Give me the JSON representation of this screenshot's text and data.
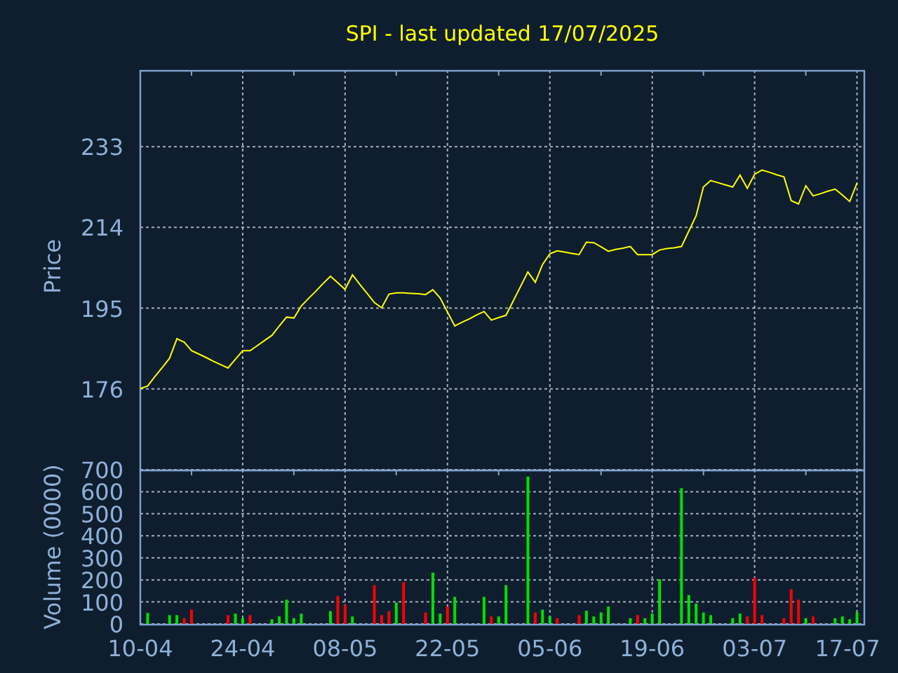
{
  "title": "SPI - last updated 17/07/2025",
  "price_chart": {
    "chart_data": {
      "type": "line",
      "grid": true,
      "ylabel": "Price",
      "ylim": [
        157,
        251
      ],
      "yticks": [
        176,
        195,
        214,
        233
      ],
      "series": [
        {
          "color": "#ffff00",
          "values": [
            176.1,
            176.7,
            178.9,
            181.0,
            183.2,
            187.8,
            187.0,
            185.0,
            184.2,
            183.4,
            182.5,
            181.7,
            180.9,
            183.0,
            185.0,
            185.0,
            186.2,
            187.4,
            188.6,
            190.8,
            192.9,
            192.7,
            195.5,
            197.3,
            199.0,
            200.8,
            202.5,
            201.0,
            199.4,
            202.8,
            200.6,
            198.5,
            196.3,
            195.1,
            198.3,
            198.6,
            198.6,
            198.5,
            198.4,
            198.2,
            199.3,
            197.4,
            194.1,
            190.8,
            191.7,
            192.5,
            193.4,
            194.2,
            192.2,
            192.8,
            193.3,
            196.7,
            200.1,
            203.5,
            201.1,
            205.3,
            207.8,
            208.5,
            208.2,
            207.9,
            207.6,
            210.5,
            210.4,
            209.4,
            208.4,
            208.8,
            209.1,
            209.5,
            207.6,
            207.6,
            207.6,
            208.7,
            209.0,
            209.2,
            209.5,
            213.1,
            216.7,
            223.5,
            225.0,
            224.5,
            224.0,
            223.5,
            226.3,
            223.2,
            226.5,
            227.5,
            227.0,
            226.4,
            225.9,
            220.3,
            219.5,
            223.8,
            221.4,
            221.9,
            222.5,
            223.0,
            221.6,
            220.1,
            224.4
          ]
        }
      ]
    }
  },
  "volume_chart": {
    "chart_data": {
      "type": "bar",
      "grid": true,
      "ylabel": "Volume (0000)",
      "ylim": [
        0,
        700
      ],
      "yticks": [
        0,
        100,
        200,
        300,
        400,
        500,
        600,
        700
      ],
      "categories": [
        "10-04",
        null,
        null,
        null,
        null,
        null,
        null,
        null,
        null,
        null,
        null,
        null,
        null,
        null,
        "24-04",
        null,
        null,
        null,
        null,
        null,
        null,
        null,
        null,
        null,
        null,
        null,
        null,
        null,
        "08-05",
        null,
        null,
        null,
        null,
        null,
        null,
        null,
        null,
        null,
        null,
        null,
        null,
        null,
        "22-05",
        null,
        null,
        null,
        null,
        null,
        null,
        null,
        null,
        null,
        null,
        null,
        null,
        null,
        "05-06",
        null,
        null,
        null,
        null,
        null,
        null,
        null,
        null,
        null,
        null,
        null,
        null,
        null,
        "19-06",
        null,
        null,
        null,
        null,
        null,
        null,
        null,
        null,
        null,
        null,
        null,
        null,
        null,
        "03-07",
        null,
        null,
        null,
        null,
        null,
        null,
        null,
        null,
        null,
        null,
        null,
        null,
        null,
        "17-07"
      ],
      "series": [
        {
          "color": "#00e000",
          "values": [
            null,
            50,
            null,
            null,
            40,
            40,
            null,
            null,
            null,
            null,
            null,
            null,
            null,
            47,
            26,
            null,
            null,
            null,
            21,
            34,
            110,
            26,
            47,
            null,
            null,
            null,
            58,
            null,
            null,
            34,
            null,
            null,
            null,
            null,
            null,
            97,
            null,
            null,
            null,
            null,
            233,
            47,
            null,
            123,
            null,
            null,
            null,
            123,
            null,
            34,
            176,
            null,
            null,
            669,
            null,
            65,
            34,
            null,
            null,
            null,
            null,
            60,
            34,
            52,
            79,
            null,
            null,
            26,
            null,
            26,
            47,
            202,
            null,
            null,
            616,
            131,
            92,
            52,
            40,
            null,
            null,
            26,
            47,
            null,
            null,
            null,
            null,
            null,
            null,
            null,
            null,
            26,
            null,
            null,
            null,
            26,
            34,
            21,
            52
          ]
        },
        {
          "color": "#ff0000",
          "values": [
            null,
            null,
            null,
            null,
            null,
            null,
            26,
            65,
            null,
            null,
            null,
            null,
            40,
            null,
            null,
            40,
            null,
            null,
            null,
            null,
            null,
            null,
            null,
            null,
            null,
            null,
            null,
            126,
            87,
            null,
            null,
            null,
            176,
            40,
            58,
            null,
            189,
            null,
            null,
            52,
            null,
            null,
            79,
            null,
            null,
            null,
            null,
            null,
            34,
            null,
            null,
            null,
            null,
            null,
            52,
            null,
            null,
            26,
            null,
            null,
            40,
            null,
            null,
            null,
            null,
            null,
            null,
            null,
            40,
            null,
            null,
            null,
            null,
            null,
            null,
            null,
            null,
            null,
            null,
            null,
            null,
            null,
            null,
            34,
            210,
            40,
            null,
            null,
            26,
            157,
            110,
            null,
            34,
            null,
            null,
            null,
            null,
            null,
            null
          ]
        }
      ]
    }
  }
}
